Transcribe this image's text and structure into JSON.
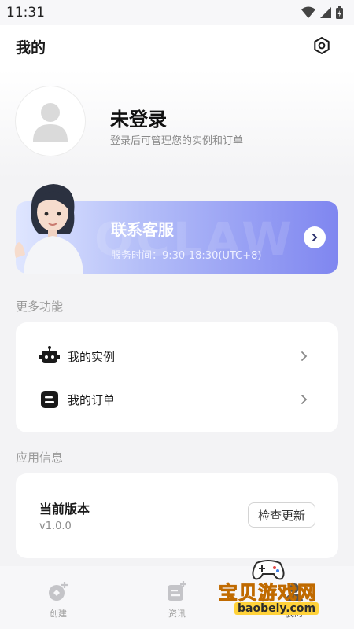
{
  "status_bar": {
    "time": "11:31"
  },
  "header": {
    "title": "我的"
  },
  "profile": {
    "title": "未登录",
    "subtitle": "登录后可管理您的实例和订单"
  },
  "service": {
    "title": "联系客服",
    "hours": "服务时间：9:30-18:30(UTC+8)",
    "watermark": "OCLAW"
  },
  "more": {
    "label": "更多功能",
    "items": [
      {
        "label": "我的实例",
        "icon": "robot-icon"
      },
      {
        "label": "我的订单",
        "icon": "order-icon"
      }
    ]
  },
  "app_info": {
    "label": "应用信息",
    "version_label": "当前版本",
    "version_value": "v1.0.0",
    "check_label": "检查更新"
  },
  "tabs": [
    {
      "label": "创建",
      "icon": "create-icon"
    },
    {
      "label": "资讯",
      "icon": "news-icon"
    },
    {
      "label": "我的",
      "icon": "mine-icon"
    }
  ],
  "promo": {
    "text": "宝贝游戏网",
    "url": "baobeiy.com"
  },
  "colors": {
    "accent": "#7f86f0",
    "promo": "#f4a81d"
  }
}
